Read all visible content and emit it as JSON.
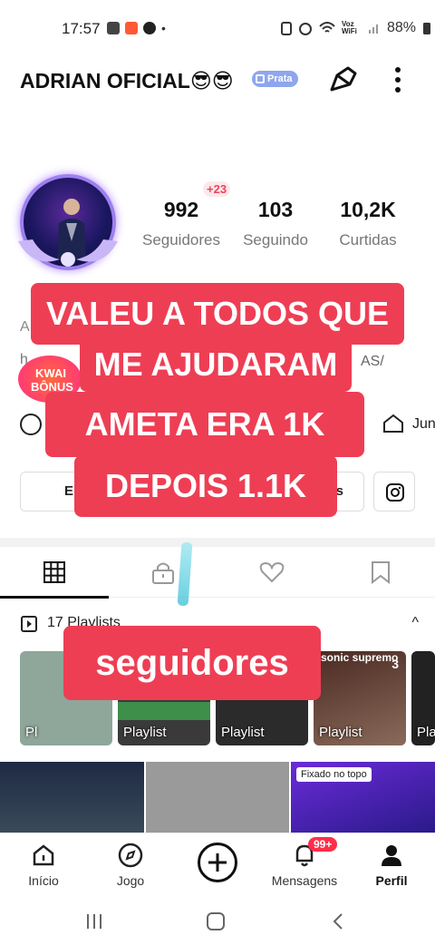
{
  "status_bar": {
    "time": "17:57",
    "dot": "•",
    "network_label": "Voz WiFi",
    "battery": "88%"
  },
  "profile": {
    "username": "ADRIAN OFICIAL😎😎",
    "rank_badge": "Prata",
    "stats": [
      {
        "value": "992",
        "label": "Seguidores",
        "delta": "+23"
      },
      {
        "value": "103",
        "label": "Seguindo"
      },
      {
        "value": "10,2K",
        "label": "Curtidas"
      }
    ],
    "bio_partial_1": "A",
    "bio_partial_2": "h",
    "bio_partial_3": "AS/",
    "kwai_bonus": "KWAI BÔNUS",
    "location_partial": "Jun",
    "edit_button_partial_left": "E",
    "edit_button_partial_right": "s"
  },
  "tabs": [
    {
      "icon": "grid-icon",
      "active": true
    },
    {
      "icon": "lock-icon",
      "active": false
    },
    {
      "icon": "heart-icon",
      "active": false
    },
    {
      "icon": "bookmark-icon",
      "active": false
    }
  ],
  "playlists": {
    "label": "17 Playlists",
    "chevron": "^",
    "cards": [
      {
        "label": "Pl",
        "color": "#8ea79a"
      },
      {
        "label": "Playlist",
        "color": "#3a3a3a"
      },
      {
        "label": "Playlist",
        "color": "#2b2b2b"
      },
      {
        "label": "Playlist",
        "title": "sonic supremo",
        "count": "3",
        "color": "#6b4a3a"
      },
      {
        "label": "Pla",
        "color": "#222222"
      }
    ]
  },
  "video_grid": {
    "pinned_label": "Fixado no topo"
  },
  "overlay": {
    "line1": "VALEU A TODOS QUE",
    "line2": "ME AJUDARAM",
    "line3": "AMETA ERA 1K",
    "line4": "DEPOIS 1.1K",
    "line5": "seguidores"
  },
  "bottom_nav": {
    "items": [
      {
        "label": "Início",
        "icon": "home-icon"
      },
      {
        "label": "Jogo",
        "icon": "compass-icon"
      },
      {
        "label": "",
        "icon": "plus-icon"
      },
      {
        "label": "Mensagens",
        "icon": "bell-icon",
        "badge": "99+"
      },
      {
        "label": "Perfil",
        "icon": "person-icon"
      }
    ]
  },
  "colors": {
    "caption_bg": "#ee3e54",
    "accent_red": "#ff2e4a",
    "badge_blue": "#8ea6ee"
  }
}
